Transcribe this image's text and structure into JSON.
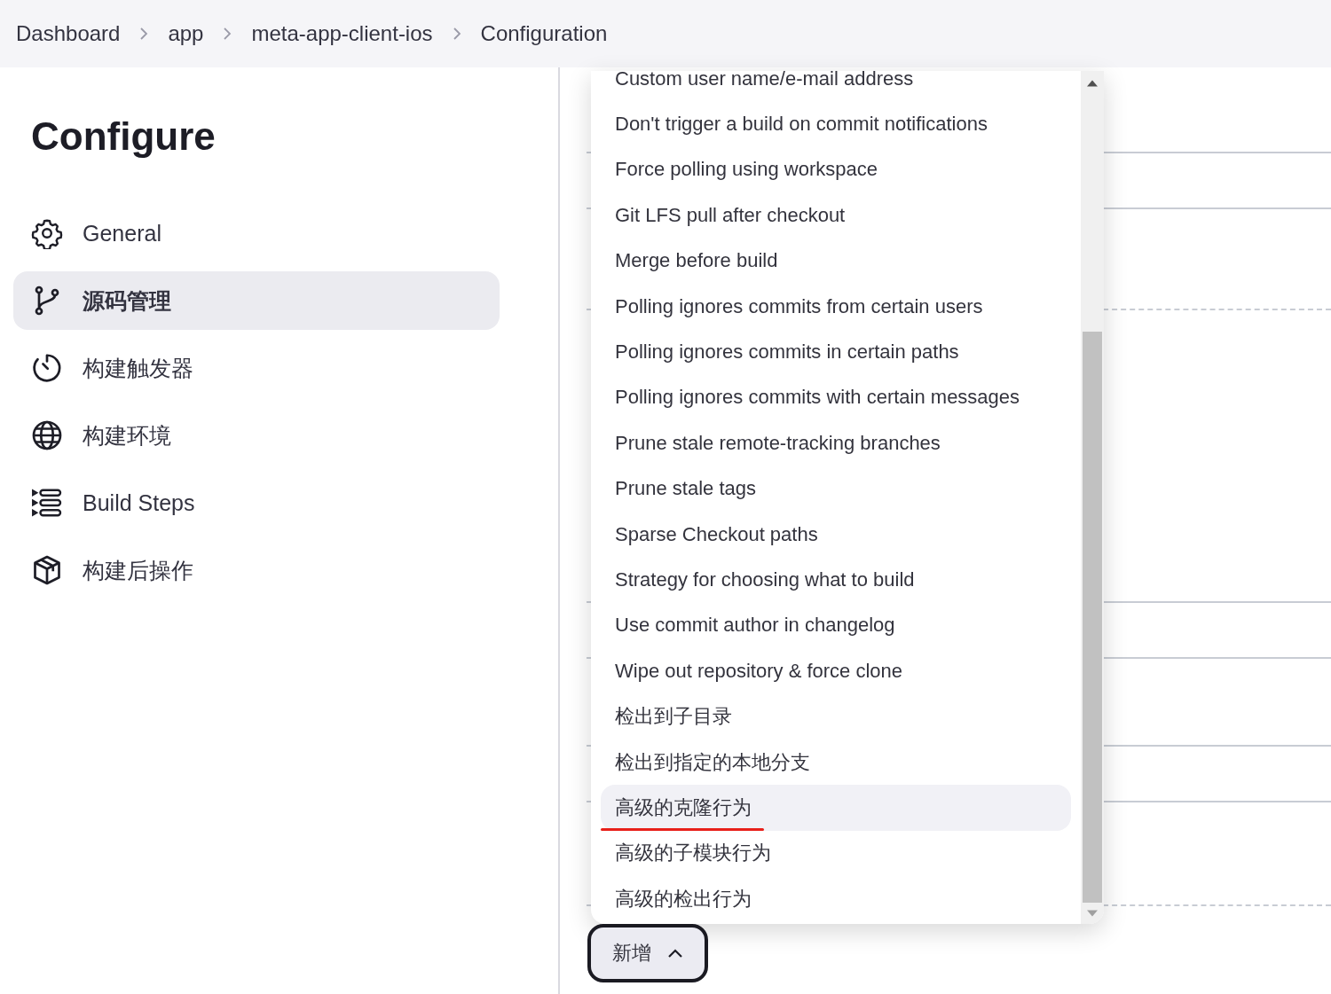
{
  "breadcrumbs": [
    {
      "label": "Dashboard"
    },
    {
      "label": "app"
    },
    {
      "label": "meta-app-client-ios"
    },
    {
      "label": "Configuration"
    }
  ],
  "page_title": "Configure",
  "sidebar": {
    "items": [
      {
        "label": "General",
        "kind": "general",
        "selected": false
      },
      {
        "label": "源码管理",
        "kind": "scm",
        "selected": true
      },
      {
        "label": "构建触发器",
        "kind": "triggers",
        "selected": false
      },
      {
        "label": "构建环境",
        "kind": "environment",
        "selected": false
      },
      {
        "label": "Build Steps",
        "kind": "steps",
        "selected": false
      },
      {
        "label": "构建后操作",
        "kind": "post",
        "selected": false
      }
    ]
  },
  "dropdown": {
    "items": [
      {
        "label": "Custom user name/e-mail address",
        "selected": false
      },
      {
        "label": "Don't trigger a build on commit notifications",
        "selected": false
      },
      {
        "label": "Force polling using workspace",
        "selected": false
      },
      {
        "label": "Git LFS pull after checkout",
        "selected": false
      },
      {
        "label": "Merge before build",
        "selected": false
      },
      {
        "label": "Polling ignores commits from certain users",
        "selected": false
      },
      {
        "label": "Polling ignores commits in certain paths",
        "selected": false
      },
      {
        "label": "Polling ignores commits with certain messages",
        "selected": false
      },
      {
        "label": "Prune stale remote-tracking branches",
        "selected": false
      },
      {
        "label": "Prune stale tags",
        "selected": false
      },
      {
        "label": "Sparse Checkout paths",
        "selected": false
      },
      {
        "label": "Strategy for choosing what to build",
        "selected": false
      },
      {
        "label": "Use commit author in changelog",
        "selected": false
      },
      {
        "label": "Wipe out repository & force clone",
        "selected": false
      },
      {
        "label": "检出到子目录",
        "selected": false
      },
      {
        "label": "检出到指定的本地分支",
        "selected": false
      },
      {
        "label": "高级的克隆行为",
        "selected": true,
        "underlined": true
      },
      {
        "label": "高级的子模块行为",
        "selected": false
      },
      {
        "label": "高级的检出行为",
        "selected": false
      }
    ]
  },
  "add_button": {
    "label": "新增",
    "expanded": true
  }
}
